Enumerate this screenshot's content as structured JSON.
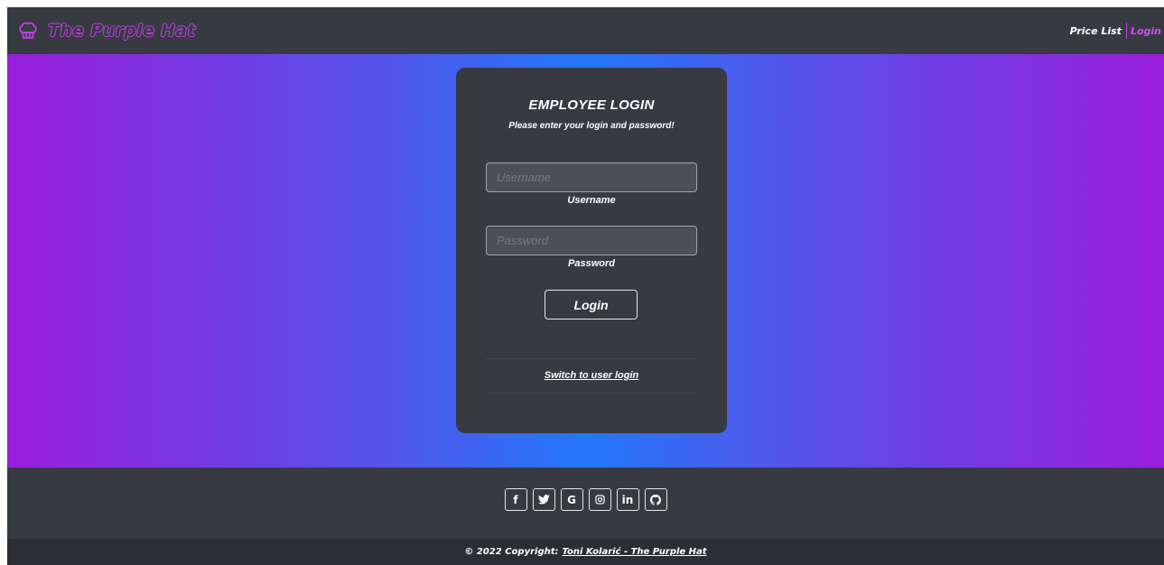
{
  "brand": {
    "name": "The Purple Hat",
    "icon": "chef-hat-icon",
    "color": "#c040e6"
  },
  "nav": {
    "price_list": "Price List",
    "login": "Login",
    "active_color": "#d04ef0"
  },
  "login_card": {
    "title": "EMPLOYEE LOGIN",
    "subtitle": "Please enter your login and password!",
    "username": {
      "placeholder": "Username",
      "value": "",
      "label": "Username"
    },
    "password": {
      "placeholder": "Password",
      "value": "",
      "label": "Password"
    },
    "submit": "Login",
    "switch_link": "Switch to user login"
  },
  "footer": {
    "social_icons": [
      "facebook-icon",
      "twitter-icon",
      "google-icon",
      "instagram-icon",
      "linkedin-icon",
      "github-icon"
    ],
    "social_glyphs": {
      "facebook": "f",
      "google": "G",
      "linkedin": "in"
    },
    "copyright_prefix": "© 2022 Copyright:",
    "copyright_link": "Toni Kolarić - The Purple Hat"
  },
  "colors": {
    "navbar_bg": "#373a40",
    "gradient_edge": "#9a1edc",
    "gradient_center": "#2478f8",
    "footer_bg": "#373a40",
    "copyright_bg": "#2c2e33"
  }
}
